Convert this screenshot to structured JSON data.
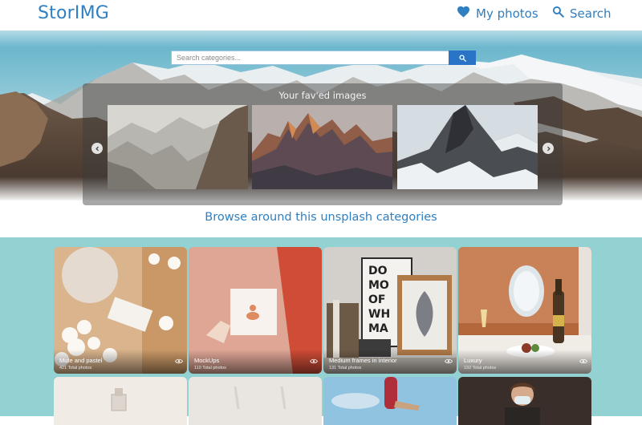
{
  "header": {
    "logo": "StorIMG",
    "nav": {
      "my_photos": "My photos",
      "search": "Search"
    }
  },
  "hero": {
    "search_placeholder": "Search categories...",
    "favorites_title": "Your fav'ed images"
  },
  "browse_title": "Browse around this unsplash categories",
  "categories": [
    {
      "name": "Mute and pastel",
      "total": "421 Total photos"
    },
    {
      "name": "MockUps",
      "total": "110 Total photos"
    },
    {
      "name": "Medium frames in interior",
      "total": "131 Total photos"
    },
    {
      "name": "Luxury",
      "total": "192 Total photos"
    }
  ],
  "colors": {
    "brand": "#2f7fc1",
    "search_button": "#2a74c8",
    "section_bg": "#93d2d3"
  },
  "icons": {
    "nav_photos": "heart-icon",
    "nav_search": "search-icon",
    "search_button": "search-icon",
    "card_view": "eye-icon",
    "prev": "chevron-left-icon",
    "next": "chevron-right-icon"
  }
}
